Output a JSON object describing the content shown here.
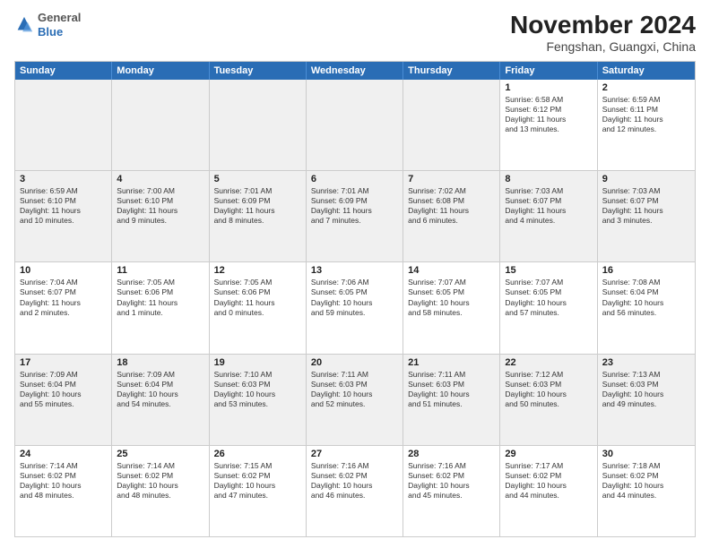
{
  "logo": {
    "general": "General",
    "blue": "Blue"
  },
  "title": "November 2024",
  "location": "Fengshan, Guangxi, China",
  "days_of_week": [
    "Sunday",
    "Monday",
    "Tuesday",
    "Wednesday",
    "Thursday",
    "Friday",
    "Saturday"
  ],
  "rows": [
    [
      {
        "day": "",
        "text": "",
        "empty": true
      },
      {
        "day": "",
        "text": "",
        "empty": true
      },
      {
        "day": "",
        "text": "",
        "empty": true
      },
      {
        "day": "",
        "text": "",
        "empty": true
      },
      {
        "day": "",
        "text": "",
        "empty": true
      },
      {
        "day": "1",
        "text": "Sunrise: 6:58 AM\nSunset: 6:12 PM\nDaylight: 11 hours\nand 13 minutes."
      },
      {
        "day": "2",
        "text": "Sunrise: 6:59 AM\nSunset: 6:11 PM\nDaylight: 11 hours\nand 12 minutes."
      }
    ],
    [
      {
        "day": "3",
        "text": "Sunrise: 6:59 AM\nSunset: 6:10 PM\nDaylight: 11 hours\nand 10 minutes."
      },
      {
        "day": "4",
        "text": "Sunrise: 7:00 AM\nSunset: 6:10 PM\nDaylight: 11 hours\nand 9 minutes."
      },
      {
        "day": "5",
        "text": "Sunrise: 7:01 AM\nSunset: 6:09 PM\nDaylight: 11 hours\nand 8 minutes."
      },
      {
        "day": "6",
        "text": "Sunrise: 7:01 AM\nSunset: 6:09 PM\nDaylight: 11 hours\nand 7 minutes."
      },
      {
        "day": "7",
        "text": "Sunrise: 7:02 AM\nSunset: 6:08 PM\nDaylight: 11 hours\nand 6 minutes."
      },
      {
        "day": "8",
        "text": "Sunrise: 7:03 AM\nSunset: 6:07 PM\nDaylight: 11 hours\nand 4 minutes."
      },
      {
        "day": "9",
        "text": "Sunrise: 7:03 AM\nSunset: 6:07 PM\nDaylight: 11 hours\nand 3 minutes."
      }
    ],
    [
      {
        "day": "10",
        "text": "Sunrise: 7:04 AM\nSunset: 6:07 PM\nDaylight: 11 hours\nand 2 minutes."
      },
      {
        "day": "11",
        "text": "Sunrise: 7:05 AM\nSunset: 6:06 PM\nDaylight: 11 hours\nand 1 minute."
      },
      {
        "day": "12",
        "text": "Sunrise: 7:05 AM\nSunset: 6:06 PM\nDaylight: 11 hours\nand 0 minutes."
      },
      {
        "day": "13",
        "text": "Sunrise: 7:06 AM\nSunset: 6:05 PM\nDaylight: 10 hours\nand 59 minutes."
      },
      {
        "day": "14",
        "text": "Sunrise: 7:07 AM\nSunset: 6:05 PM\nDaylight: 10 hours\nand 58 minutes."
      },
      {
        "day": "15",
        "text": "Sunrise: 7:07 AM\nSunset: 6:05 PM\nDaylight: 10 hours\nand 57 minutes."
      },
      {
        "day": "16",
        "text": "Sunrise: 7:08 AM\nSunset: 6:04 PM\nDaylight: 10 hours\nand 56 minutes."
      }
    ],
    [
      {
        "day": "17",
        "text": "Sunrise: 7:09 AM\nSunset: 6:04 PM\nDaylight: 10 hours\nand 55 minutes."
      },
      {
        "day": "18",
        "text": "Sunrise: 7:09 AM\nSunset: 6:04 PM\nDaylight: 10 hours\nand 54 minutes."
      },
      {
        "day": "19",
        "text": "Sunrise: 7:10 AM\nSunset: 6:03 PM\nDaylight: 10 hours\nand 53 minutes."
      },
      {
        "day": "20",
        "text": "Sunrise: 7:11 AM\nSunset: 6:03 PM\nDaylight: 10 hours\nand 52 minutes."
      },
      {
        "day": "21",
        "text": "Sunrise: 7:11 AM\nSunset: 6:03 PM\nDaylight: 10 hours\nand 51 minutes."
      },
      {
        "day": "22",
        "text": "Sunrise: 7:12 AM\nSunset: 6:03 PM\nDaylight: 10 hours\nand 50 minutes."
      },
      {
        "day": "23",
        "text": "Sunrise: 7:13 AM\nSunset: 6:03 PM\nDaylight: 10 hours\nand 49 minutes."
      }
    ],
    [
      {
        "day": "24",
        "text": "Sunrise: 7:14 AM\nSunset: 6:02 PM\nDaylight: 10 hours\nand 48 minutes."
      },
      {
        "day": "25",
        "text": "Sunrise: 7:14 AM\nSunset: 6:02 PM\nDaylight: 10 hours\nand 48 minutes."
      },
      {
        "day": "26",
        "text": "Sunrise: 7:15 AM\nSunset: 6:02 PM\nDaylight: 10 hours\nand 47 minutes."
      },
      {
        "day": "27",
        "text": "Sunrise: 7:16 AM\nSunset: 6:02 PM\nDaylight: 10 hours\nand 46 minutes."
      },
      {
        "day": "28",
        "text": "Sunrise: 7:16 AM\nSunset: 6:02 PM\nDaylight: 10 hours\nand 45 minutes."
      },
      {
        "day": "29",
        "text": "Sunrise: 7:17 AM\nSunset: 6:02 PM\nDaylight: 10 hours\nand 44 minutes."
      },
      {
        "day": "30",
        "text": "Sunrise: 7:18 AM\nSunset: 6:02 PM\nDaylight: 10 hours\nand 44 minutes."
      }
    ]
  ]
}
